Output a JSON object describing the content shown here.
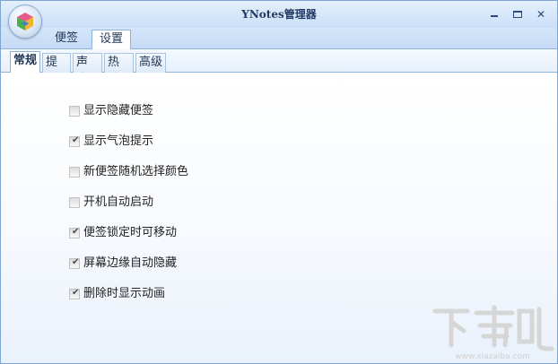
{
  "window": {
    "title": "YNotes管理器"
  },
  "main_tabs": [
    "便签",
    "设置"
  ],
  "sub_tabs": [
    "常规",
    "提醒",
    "声音",
    "热键",
    "高级"
  ],
  "active_sub_tab": "常规",
  "options": [
    {
      "label": "显示隐藏便签",
      "checked": false
    },
    {
      "label": "显示气泡提示",
      "checked": true
    },
    {
      "label": "新便签随机选择颜色",
      "checked": false
    },
    {
      "label": "开机自动启动",
      "checked": false
    },
    {
      "label": "便签锁定时可移动",
      "checked": true
    },
    {
      "label": "屏幕边缘自动隐藏",
      "checked": true
    },
    {
      "label": "删除时显示动画",
      "checked": true
    }
  ],
  "watermark": {
    "brand": "下载吧",
    "url": "www.xiazaiba.com"
  },
  "colors": {
    "accent": "#7fa6d2",
    "title": "#223a64",
    "bg_tab": "#cadff7"
  }
}
